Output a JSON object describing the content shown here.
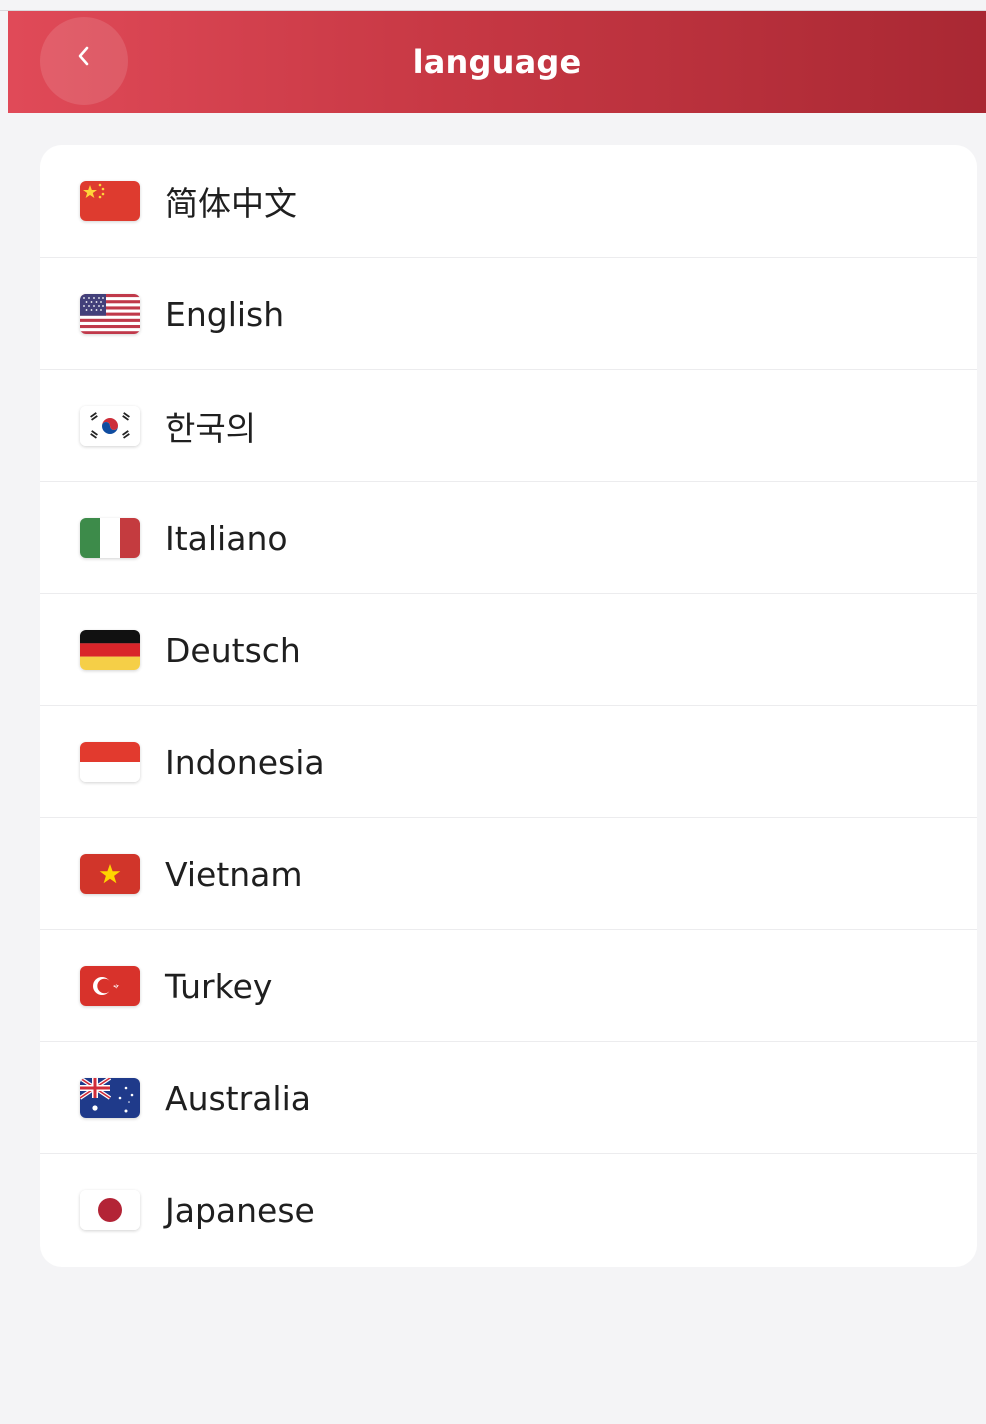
{
  "header": {
    "title": "language",
    "back_icon": "chevron-left-icon",
    "gradient": [
      "#e04a58",
      "#a92833"
    ]
  },
  "languages": [
    {
      "label": "简体中文",
      "flag": "china-flag-icon"
    },
    {
      "label": "English",
      "flag": "usa-flag-icon"
    },
    {
      "label": "한국의",
      "flag": "south-korea-flag-icon"
    },
    {
      "label": "Italiano",
      "flag": "italy-flag-icon"
    },
    {
      "label": "Deutsch",
      "flag": "germany-flag-icon"
    },
    {
      "label": "Indonesia",
      "flag": "indonesia-flag-icon"
    },
    {
      "label": "Vietnam",
      "flag": "vietnam-flag-icon"
    },
    {
      "label": "Turkey",
      "flag": "turkey-flag-icon"
    },
    {
      "label": "Australia",
      "flag": "australia-flag-icon"
    },
    {
      "label": "Japanese",
      "flag": "japan-flag-icon"
    }
  ]
}
